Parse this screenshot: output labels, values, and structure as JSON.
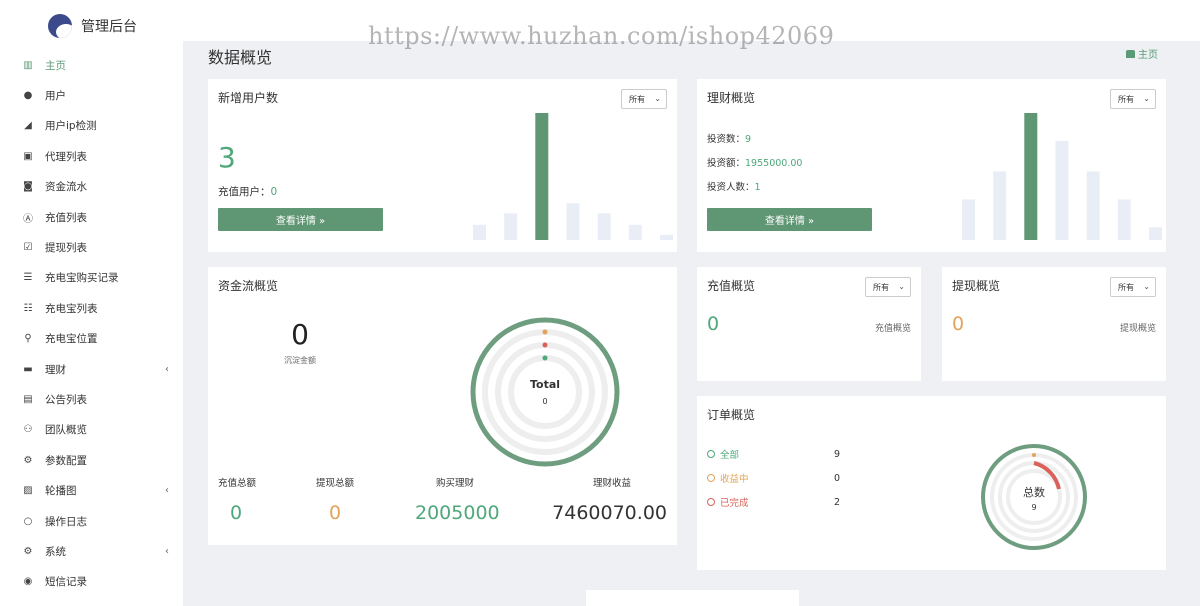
{
  "brand": {
    "title": "管理后台"
  },
  "watermark": "https://www.huzhan.com/ishop42069",
  "page": {
    "title": "数据概览",
    "crumb": "主页"
  },
  "sidebar": {
    "items": [
      {
        "label": "主页",
        "icon": "bar-chart-icon",
        "glyph": "▥",
        "active": true
      },
      {
        "label": "用户",
        "icon": "user-icon",
        "glyph": "●"
      },
      {
        "label": "用户ip检测",
        "icon": "signal-icon",
        "glyph": "◢"
      },
      {
        "label": "代理列表",
        "icon": "contact-card-icon",
        "glyph": "▣"
      },
      {
        "label": "资金流水",
        "icon": "money-icon",
        "glyph": "◙"
      },
      {
        "label": "充值列表",
        "icon": "font-icon",
        "glyph": "Ⓐ"
      },
      {
        "label": "提现列表",
        "icon": "check-square-icon",
        "glyph": "☑"
      },
      {
        "label": "充电宝购买记录",
        "icon": "list-icon",
        "glyph": "☰"
      },
      {
        "label": "充电宝列表",
        "icon": "list-alt-icon",
        "glyph": "☷"
      },
      {
        "label": "充电宝位置",
        "icon": "map-marker-icon",
        "glyph": "⚲"
      },
      {
        "label": "理财",
        "icon": "archive-icon",
        "glyph": "▬",
        "arrow": "‹"
      },
      {
        "label": "公告列表",
        "icon": "file-icon",
        "glyph": "▤"
      },
      {
        "label": "团队概览",
        "icon": "users-icon",
        "glyph": "⚇"
      },
      {
        "label": "参数配置",
        "icon": "cogs-icon",
        "glyph": "⚙"
      },
      {
        "label": "轮播图",
        "icon": "image-icon",
        "glyph": "▨",
        "arrow": "‹"
      },
      {
        "label": "操作日志",
        "icon": "circle-icon",
        "glyph": "○"
      },
      {
        "label": "系统",
        "icon": "gear-icon",
        "glyph": "⚙",
        "arrow": "‹"
      },
      {
        "label": "短信记录",
        "icon": "comment-icon",
        "glyph": "◉"
      }
    ]
  },
  "new_users": {
    "title": "新增用户数",
    "select": "所有",
    "count": "3",
    "recharge_label": "充值用户：",
    "recharge_value": "0",
    "button": "查看详情 »",
    "bar_levels": [
      0.12,
      0.21,
      1.0,
      0.29,
      0.21,
      0.12,
      0.04
    ]
  },
  "finance": {
    "title": "理财概览",
    "select": "所有",
    "rows": [
      {
        "label": "投资数：",
        "value": "9"
      },
      {
        "label": "投资额：",
        "value": "1955000.00"
      },
      {
        "label": "投资人数：",
        "value": "1"
      }
    ],
    "button": "查看详情 »",
    "bar_levels": [
      0.32,
      0.54,
      1.0,
      0.78,
      0.54,
      0.32,
      0.1
    ]
  },
  "fund_flow": {
    "title": "资金流概览",
    "balance": "0",
    "balance_label": "沉淀金额",
    "ring_title": "Total",
    "ring_value": "0",
    "stats": [
      {
        "label": "充值总额",
        "value": "0",
        "color": "green"
      },
      {
        "label": "提现总额",
        "value": "0",
        "color": "orange"
      },
      {
        "label": "购买理财",
        "value": "2005000",
        "color": "green"
      },
      {
        "label": "理财收益",
        "value": "7460070.00",
        "color": "dark"
      }
    ]
  },
  "recharge": {
    "title": "充值概览",
    "select": "所有",
    "value": "0",
    "caption": "充值概览"
  },
  "withdraw": {
    "title": "提现概览",
    "select": "所有",
    "value": "0",
    "caption": "提现概览"
  },
  "orders": {
    "title": "订单概览",
    "legend": [
      {
        "label": "全部",
        "value": "9",
        "color": "#4fa77a"
      },
      {
        "label": "收益中",
        "value": "0",
        "color": "#e2a35a"
      },
      {
        "label": "已完成",
        "value": "2",
        "color": "#d9625a"
      }
    ],
    "ring_title": "总数",
    "ring_value": "9"
  }
}
